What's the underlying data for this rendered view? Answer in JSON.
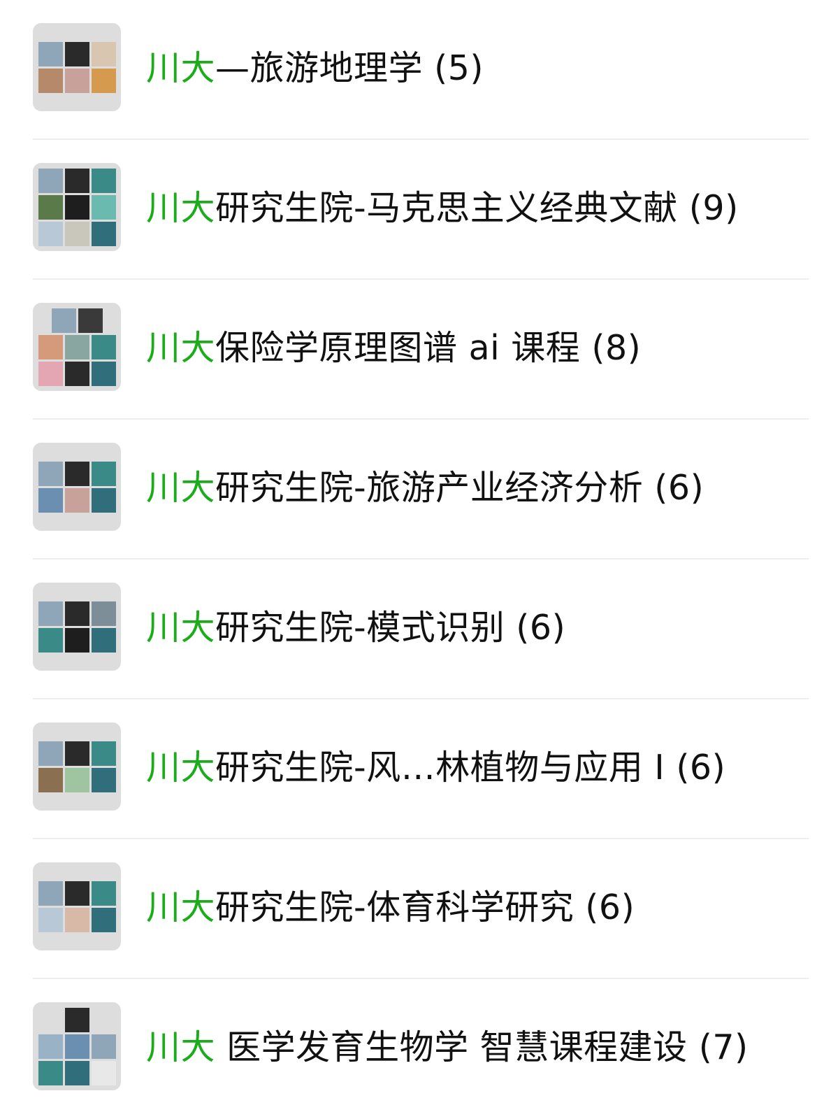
{
  "accent_color": "#1aad19",
  "items": [
    {
      "highlight": "川大",
      "rest": "—旅游地理学",
      "count": "(5)",
      "tiles": [
        "#8ea6b8",
        "#2a2a2a",
        "#d8c6b0",
        "#b48a6a",
        "#c8a29a",
        "#d59a4e"
      ]
    },
    {
      "highlight": "川大",
      "rest": "研究生院-马克思主义经典文献",
      "count": "(9)",
      "tiles": [
        "#8ea6b8",
        "#2a2a2a",
        "#3a8a88",
        "#5b7a4a",
        "#1e1e1e",
        "#6bbab0",
        "#b9c8d6",
        "#c9c6bc",
        "#2f6e7a"
      ]
    },
    {
      "highlight": "川大",
      "rest": "保险学原理图谱 ai 课程",
      "count": "(8)",
      "tiles": [
        "#8ea6b8",
        "#3a3a3a",
        "#d59a7a",
        "#8aa6a0",
        "#3a8a88",
        "#e4a6b2",
        "#2a2a2a",
        "#2f6e7a"
      ]
    },
    {
      "highlight": "川大",
      "rest": "研究生院-旅游产业经济分析",
      "count": "(6)",
      "tiles": [
        "#8ea6b8",
        "#2a2a2a",
        "#3a8a88",
        "#6a8fb0",
        "#c8a29a",
        "#2f6e7a"
      ]
    },
    {
      "highlight": "川大",
      "rest": "研究生院-模式识别",
      "count": "(6)",
      "tiles": [
        "#8ea6b8",
        "#2a2a2a",
        "#7e8e98",
        "#3a8a88",
        "#1e1e1e",
        "#2f6e7a"
      ]
    },
    {
      "highlight": "川大",
      "rest": "研究生院-风…林植物与应用 I",
      "count": "(6)",
      "tiles": [
        "#8ea6b8",
        "#2a2a2a",
        "#3a8a88",
        "#8a7050",
        "#9ec4a0",
        "#2f6e7a"
      ]
    },
    {
      "highlight": "川大",
      "rest": "研究生院-体育科学研究",
      "count": "(6)",
      "tiles": [
        "#8ea6b8",
        "#2a2a2a",
        "#3a8a88",
        "#b9c8d6",
        "#d8b8a6",
        "#2f6e7a"
      ]
    },
    {
      "highlight": "川大",
      "rest": " 医学发育生物学 智慧课程建设",
      "count": "(7)",
      "tiles": [
        "#2a2a2a",
        "#9ab2c6",
        "#6a8fb0",
        "#8ea6b8",
        "#3a8a88",
        "#2f6e7a",
        "#e8e8e8"
      ]
    }
  ]
}
